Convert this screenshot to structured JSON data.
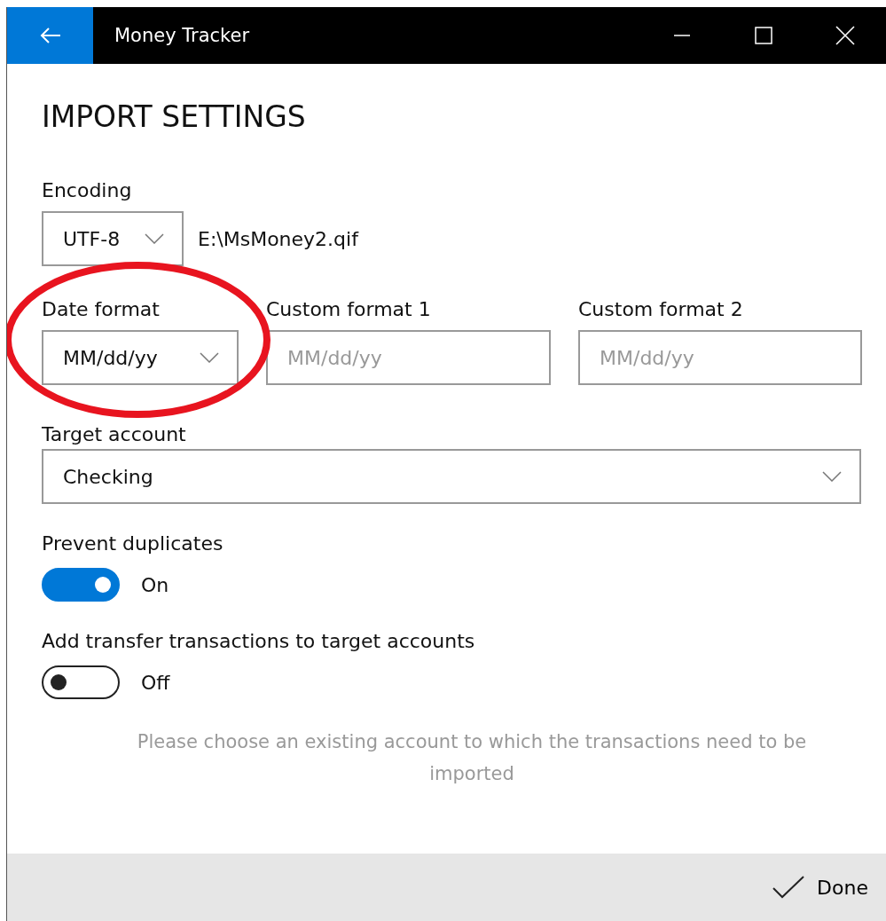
{
  "window": {
    "title": "Money Tracker"
  },
  "page_title": "IMPORT SETTINGS",
  "encoding": {
    "label": "Encoding",
    "value": "UTF-8",
    "file": "E:\\MsMoney2.qif"
  },
  "date_format": {
    "label": "Date format",
    "value": "MM/dd/yy"
  },
  "custom_formats": [
    {
      "label": "Custom format 1",
      "placeholder": "MM/dd/yy"
    },
    {
      "label": "Custom format 2",
      "placeholder": "MM/dd/yy"
    }
  ],
  "target_account": {
    "label": "Target account",
    "value": "Checking"
  },
  "toggles": [
    {
      "label": "Prevent duplicates",
      "on": true,
      "state_text": "On"
    },
    {
      "label": "Add transfer transactions to target accounts",
      "on": false,
      "state_text": "Off"
    }
  ],
  "message": "Please choose an existing account to which the transactions need to be imported",
  "footer": {
    "button": "Done"
  }
}
